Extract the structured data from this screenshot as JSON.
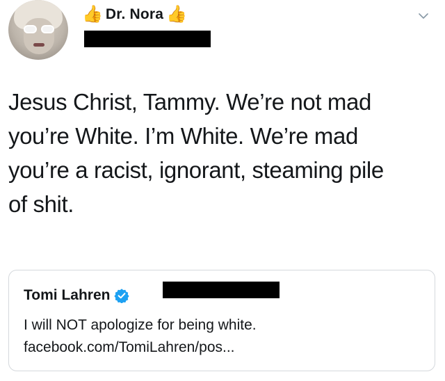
{
  "author": {
    "display_name": "Dr. Nora",
    "emoji_left": "👍",
    "emoji_right": "👍"
  },
  "tweet": {
    "text": "Jesus Christ, Tammy. We’re not mad\nyou’re White. I’m White. We’re mad\nyou’re a racist, ignorant, steaming pile\nof shit."
  },
  "quoted_tweet": {
    "display_name": "Tomi Lahren",
    "verified": true,
    "text": "I will NOT apologize for being white.",
    "link": "facebook.com/TomiLahren/pos..."
  },
  "colors": {
    "text": "#14171a",
    "verified_badge": "#1da1f2",
    "border": "#d4d8dc",
    "redaction": "#000000"
  },
  "icons": {
    "menu": "chevron-down-icon",
    "verified": "verified-badge-icon"
  }
}
